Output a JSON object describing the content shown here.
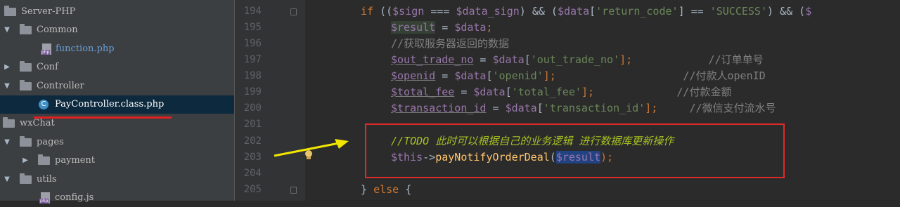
{
  "tree": {
    "items": [
      {
        "label": "Server-PHP",
        "type": "folder",
        "arrow": ""
      },
      {
        "label": "Common",
        "type": "folder",
        "arrow": "▼"
      },
      {
        "label": "function.php",
        "type": "php-file",
        "arrow": ""
      },
      {
        "label": "Conf",
        "type": "folder",
        "arrow": "▶"
      },
      {
        "label": "Controller",
        "type": "folder",
        "arrow": "▼"
      },
      {
        "label": "PayController.class.php",
        "type": "class-file",
        "arrow": "",
        "icon_letter": "C"
      },
      {
        "label": "wxChat",
        "type": "folder",
        "arrow": ""
      },
      {
        "label": "pages",
        "type": "folder",
        "arrow": "▼"
      },
      {
        "label": "payment",
        "type": "folder",
        "arrow": "▶"
      },
      {
        "label": "utils",
        "type": "folder",
        "arrow": "▼"
      },
      {
        "label": "config.js",
        "type": "file",
        "arrow": ""
      }
    ]
  },
  "gutter": {
    "line_numbers": [
      "194",
      "195",
      "196",
      "197",
      "198",
      "199",
      "200",
      "201",
      "202",
      "203",
      "204",
      "205"
    ]
  },
  "code": {
    "l194": {
      "a": "if",
      "b": " ((",
      "c": "$sign",
      "d": " === ",
      "e": "$data_sign",
      "f": ") && (",
      "g": "$data",
      "h": "[",
      "i": "'return_code'",
      "j": "] == ",
      "k": "'SUCCESS'",
      "l": ") && (",
      "m": "$"
    },
    "l195": {
      "a": "$result",
      "b": " = ",
      "c": "$data",
      "d": ";"
    },
    "l196": {
      "a": "//获取服务器返回的数据"
    },
    "l197": {
      "a": "$out_trade_no",
      "b": " = ",
      "c": "$data",
      "d": "[",
      "e": "'out_trade_no'",
      "f": "];",
      "g": "            //订单单号"
    },
    "l198": {
      "a": "$openid",
      "b": " = ",
      "c": "$data",
      "d": "[",
      "e": "'openid'",
      "f": "];",
      "g": "                    //付款人openID"
    },
    "l199": {
      "a": "$total_fee",
      "b": " = ",
      "c": "$data",
      "d": "[",
      "e": "'total_fee'",
      "f": "];",
      "g": "             //付款金额"
    },
    "l200": {
      "a": "$transaction_id",
      "b": " = ",
      "c": "$data",
      "d": "[",
      "e": "'transaction_id'",
      "f": "];",
      "g": "     //微信支付流水号"
    },
    "l202": {
      "a": "//",
      "b": "TODO 此时可以根据自己的业务逻辑 进行数据库更新操作"
    },
    "l203": {
      "a": "$this",
      "b": "->",
      "c": "payNotifyOrderDeal",
      "d": "(",
      "e": "$result",
      "f": ");"
    },
    "l205": {
      "a": "} ",
      "b": "else",
      "c": " {"
    }
  },
  "colors": {
    "annotation_red": "#e02a2a",
    "arrow_yellow": "#f2e600",
    "background": "#2b2b2b"
  }
}
